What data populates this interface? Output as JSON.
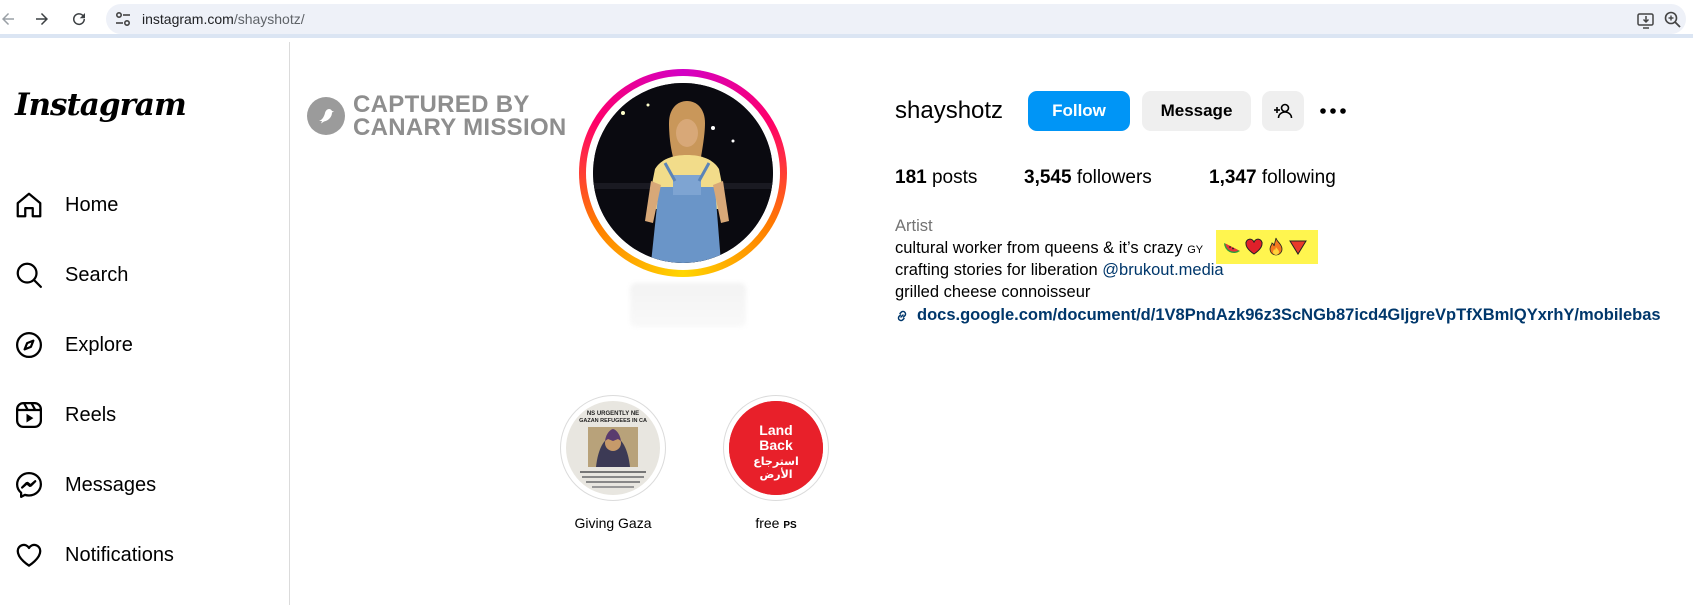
{
  "browser": {
    "url_host": "instagram.com",
    "url_path": "/shayshotz/"
  },
  "sidebar": {
    "logo": "Instagram",
    "items": [
      {
        "label": "Home",
        "icon": "home-icon"
      },
      {
        "label": "Search",
        "icon": "search-icon"
      },
      {
        "label": "Explore",
        "icon": "compass-icon"
      },
      {
        "label": "Reels",
        "icon": "reels-icon"
      },
      {
        "label": "Messages",
        "icon": "messenger-icon"
      },
      {
        "label": "Notifications",
        "icon": "heart-icon"
      }
    ]
  },
  "watermark": {
    "line1": "CAPTURED BY",
    "line2": "CANARY MISSION"
  },
  "profile": {
    "username": "shayshotz",
    "follow_label": "Follow",
    "message_label": "Message",
    "stats": {
      "posts_count": "181",
      "posts_label": "posts",
      "followers_count": "3,545",
      "followers_label": "followers",
      "following_count": "1,347",
      "following_label": "following"
    },
    "bio": {
      "category": "Artist",
      "line1": "cultural worker from queens & it’s crazy",
      "line1_suffix": "GY",
      "emojis": [
        "watermelon-emoji",
        "red-heart-emoji",
        "fire-emoji",
        "red-triangle-emoji"
      ],
      "line2_prefix": "crafting stories for liberation",
      "line2_mention": "@brukout.media",
      "line3": "grilled cheese connoisseur",
      "link": "docs.google.com/document/d/1V8PndAzk96z3ScNGb87icd4GIjgreVpTfXBmlQYxrhY/mobilebas"
    }
  },
  "highlights": [
    {
      "label": "Giving Gaza",
      "cover_text_top": "NS URGENTLY NE",
      "cover_text_2": "GAZAN REFUGEES IN CA"
    },
    {
      "label": "free",
      "label_suffix": "PS",
      "cover_line1": "Land",
      "cover_line2": "Back",
      "cover_line3": "استرجاع",
      "cover_line4": "الأرض"
    }
  ],
  "colors": {
    "accent": "#0095f6",
    "link": "#00376b",
    "highlight": "#fff54f",
    "land_back_red": "#e8202a"
  }
}
